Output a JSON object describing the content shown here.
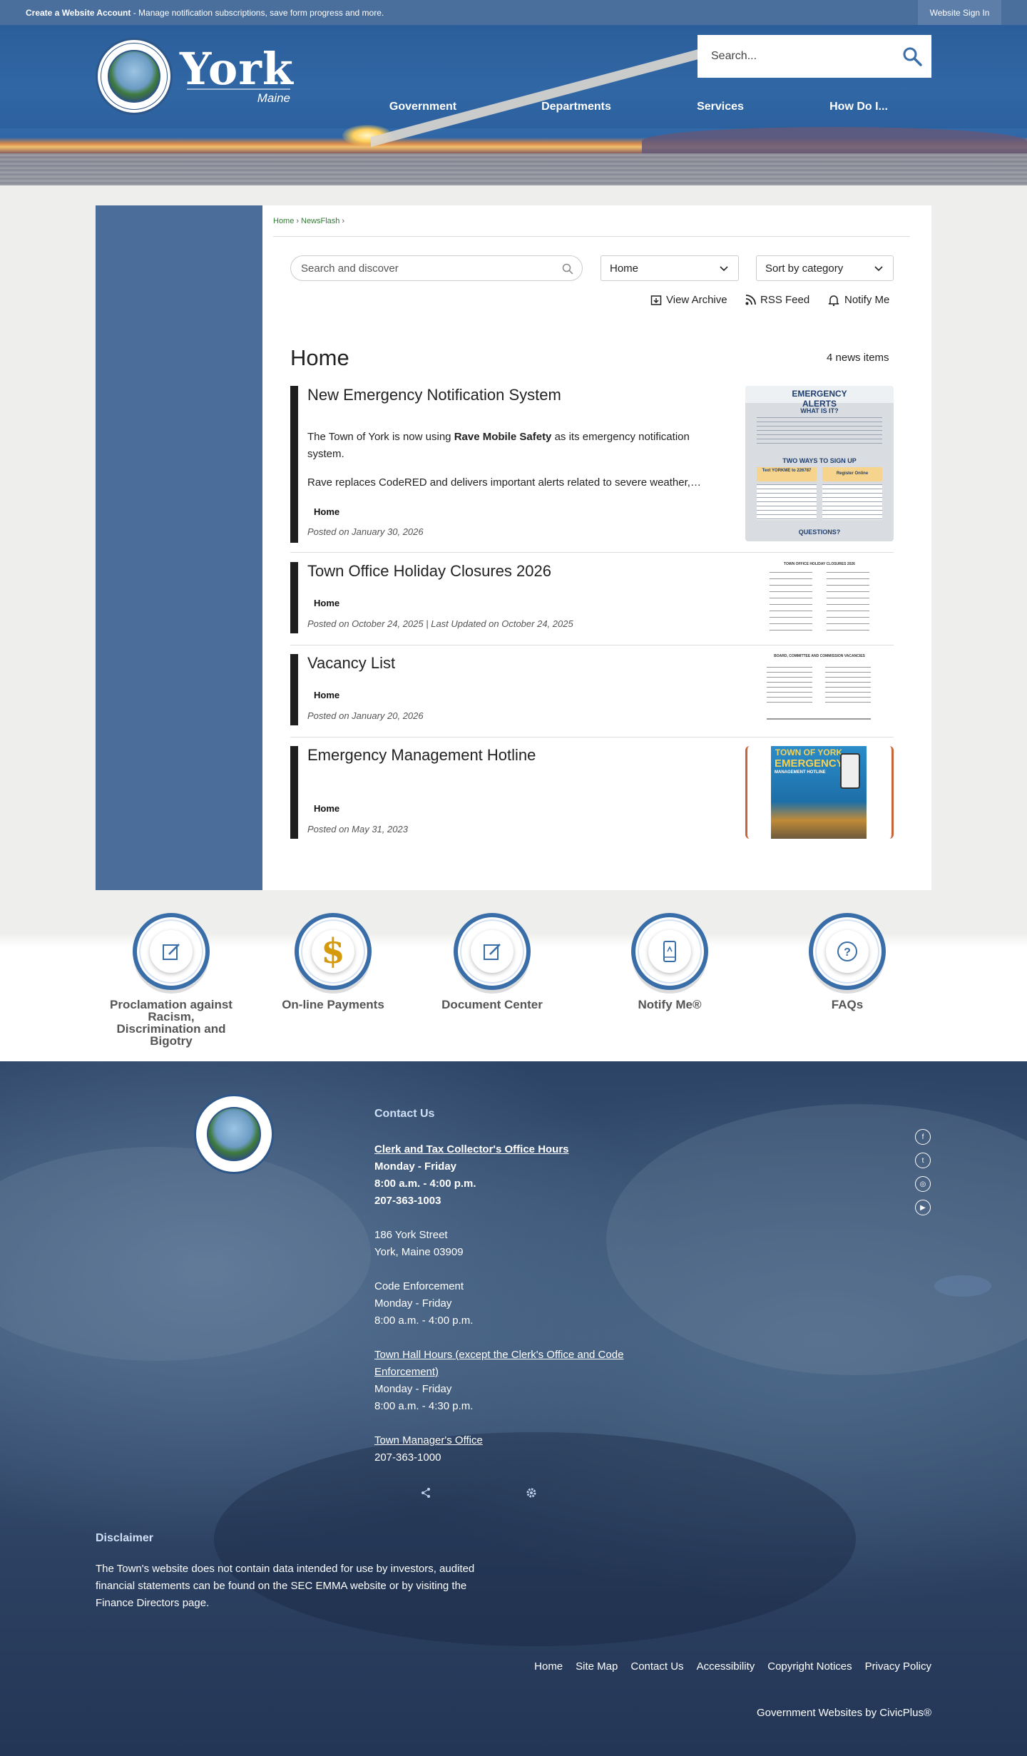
{
  "topbar": {
    "account_bold": "Create a Website Account",
    "account_rest": " - Manage notification subscriptions, save form progress and more.",
    "signin": "Website Sign In"
  },
  "header": {
    "logo_title": "York",
    "logo_subtitle": "Maine",
    "search_placeholder": "Search...",
    "nav": [
      "Government",
      "Departments",
      "Services",
      "How Do I..."
    ]
  },
  "breadcrumb": {
    "home": "Home",
    "newsflash": "NewsFlash"
  },
  "toolbar": {
    "search_placeholder": "Search and discover",
    "category_value": "Home",
    "sort_value": "Sort by category",
    "view_archive": "View Archive",
    "rss_feed": "RSS Feed",
    "notify_me": "Notify Me"
  },
  "section": {
    "title": "Home",
    "count": "4 news items"
  },
  "news": [
    {
      "title": "New Emergency Notification System",
      "para1_pre": "The Town of York is now using ",
      "para1_bold": "Rave Mobile Safety",
      "para1_post": " as its emergency notification system.",
      "para2": "Rave replaces CodeRED and delivers important alerts related to severe weather,…",
      "category": "Home",
      "posted": "Posted on January 30, 2026"
    },
    {
      "title": "Town Office Holiday Closures 2026",
      "category": "Home",
      "posted": "Posted on October 24, 2025 | Last Updated on October 24, 2025"
    },
    {
      "title": "Vacancy List",
      "category": "Home",
      "posted": "Posted on January 20, 2026"
    },
    {
      "title": "Emergency Management Hotline",
      "category": "Home",
      "posted": "Posted on May 31, 2023"
    }
  ],
  "thumbs": {
    "alerts_title": "EMERGENCY ALERTS",
    "what": "WHAT IS IT?",
    "two_ways": "TWO WAYS TO SIGN UP",
    "text_label": "Text YORKME to 226787",
    "register": "Register Online",
    "questions": "QUESTIONS?",
    "holiday_title": "TOWN OFFICE HOLIDAY CLOSURES 2026",
    "vacancy_title": "BOARD, COMMITTEE AND COMMISSION VACANCIES",
    "hotline_town": "TOWN OF YORK",
    "hotline_big": "EMERGENCY",
    "hotline_sub": "MANAGEMENT HOTLINE"
  },
  "quicklinks": [
    {
      "label": "Proclamation against Racism, Discrimination and Bigotry",
      "icon": "edit-icon"
    },
    {
      "label": "On-line Payments",
      "icon": "dollar-icon"
    },
    {
      "label": "Document Center",
      "icon": "edit-icon"
    },
    {
      "label": "Notify Me®",
      "icon": "phone-icon"
    },
    {
      "label": "FAQs",
      "icon": "question-icon"
    }
  ],
  "footer": {
    "contact_heading": "Contact Us",
    "clerk_heading": "Clerk and Tax Collector's Office Hours",
    "clerk_days": "Monday - Friday",
    "clerk_hours": "8:00 a.m. - 4:00 p.m.",
    "clerk_phone": "207-363-1003",
    "street": "186 York Street",
    "city": "York, Maine 03909",
    "code_heading": "Code Enforcement",
    "code_days": "Monday - Friday",
    "code_hours": "8:00 a.m. - 4:00 p.m.",
    "townhall_heading": "Town Hall Hours (except the Clerk's Office and Code Enforcement)",
    "townhall_days": "Monday - Friday",
    "townhall_hours": "8:00 a.m. - 4:30 p.m.",
    "manager_heading": "Town Manager's Office",
    "manager_phone": "207-363-1000",
    "disclaimer_heading": "Disclaimer",
    "disclaimer_text": "The Town's website does not contain data intended for use by investors, audited financial statements can be found on the SEC EMMA website or by visiting the Finance Directors page.",
    "links": [
      "Home",
      "Site Map",
      "Contact Us",
      "Accessibility",
      "Copyright Notices",
      "Privacy Policy"
    ],
    "civic": "Government Websites by CivicPlus®",
    "social": [
      "facebook-icon",
      "twitter-icon",
      "instagram-icon",
      "youtube-icon"
    ]
  },
  "colors": {
    "topbar": "#4a6f9c",
    "sidebar": "#4a6e99",
    "accent_green": "#2e7d32",
    "quicklink_ring": "#3a6ea8",
    "footer_bg": "#2c4466"
  }
}
